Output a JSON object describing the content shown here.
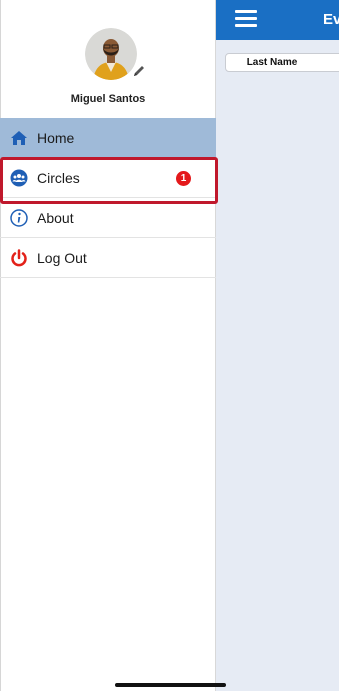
{
  "app": {
    "title_fragment": "Ev",
    "column_header": "Last Name"
  },
  "profile": {
    "name": "Miguel Santos",
    "avatar_icon": "user-avatar",
    "edit_icon": "pencil-icon"
  },
  "menu": {
    "items": [
      {
        "label": "Home",
        "icon": "home-icon",
        "active": true
      },
      {
        "label": "Circles",
        "icon": "people-icon",
        "badge": "1"
      },
      {
        "label": "About",
        "icon": "info-icon"
      },
      {
        "label": "Log Out",
        "icon": "power-icon"
      }
    ]
  },
  "colors": {
    "topbar": "#1a6fc4",
    "active_item": "#9fbad8",
    "icon_blue": "#1f5fb5",
    "badge": "#e4191b",
    "logout_red": "#e32119",
    "highlight_border": "#c0182c"
  }
}
